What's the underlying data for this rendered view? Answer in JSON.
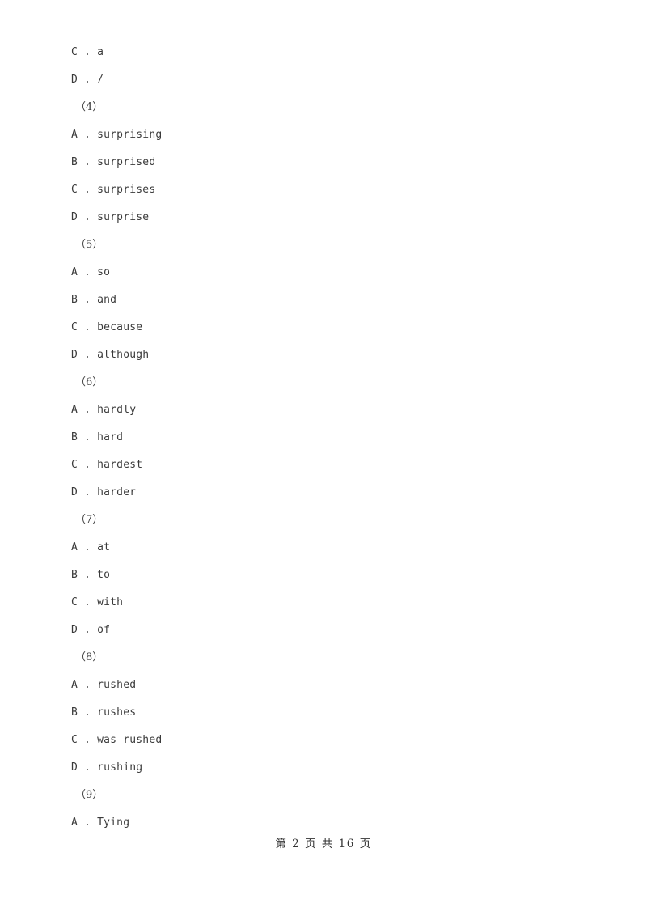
{
  "document": {
    "page_background": "#ffffff",
    "text_color": "#3a3a3a",
    "footer_color": "#333333"
  },
  "content_lines": [
    {
      "type": "option",
      "text": "C . a"
    },
    {
      "type": "option",
      "text": "D . /"
    },
    {
      "type": "qnum",
      "text": "（4）"
    },
    {
      "type": "option",
      "text": "A . surprising"
    },
    {
      "type": "option",
      "text": "B . surprised"
    },
    {
      "type": "option",
      "text": "C . surprises"
    },
    {
      "type": "option",
      "text": "D . surprise"
    },
    {
      "type": "qnum",
      "text": "（5）"
    },
    {
      "type": "option",
      "text": "A . so"
    },
    {
      "type": "option",
      "text": "B . and"
    },
    {
      "type": "option",
      "text": "C . because"
    },
    {
      "type": "option",
      "text": "D . although"
    },
    {
      "type": "qnum",
      "text": "（6）"
    },
    {
      "type": "option",
      "text": "A . hardly"
    },
    {
      "type": "option",
      "text": "B . hard"
    },
    {
      "type": "option",
      "text": "C . hardest"
    },
    {
      "type": "option",
      "text": "D . harder"
    },
    {
      "type": "qnum",
      "text": "（7）"
    },
    {
      "type": "option",
      "text": "A . at"
    },
    {
      "type": "option",
      "text": "B . to"
    },
    {
      "type": "option",
      "text": "C . with"
    },
    {
      "type": "option",
      "text": "D . of"
    },
    {
      "type": "qnum",
      "text": "（8）"
    },
    {
      "type": "option",
      "text": "A . rushed"
    },
    {
      "type": "option",
      "text": "B . rushes"
    },
    {
      "type": "option",
      "text": "C . was rushed"
    },
    {
      "type": "option",
      "text": "D . rushing"
    },
    {
      "type": "qnum",
      "text": "（9）"
    },
    {
      "type": "option",
      "text": "A . Tying"
    }
  ],
  "footer": {
    "text": "第 2 页 共 16 页",
    "current_page": "2",
    "total_pages": "16"
  }
}
